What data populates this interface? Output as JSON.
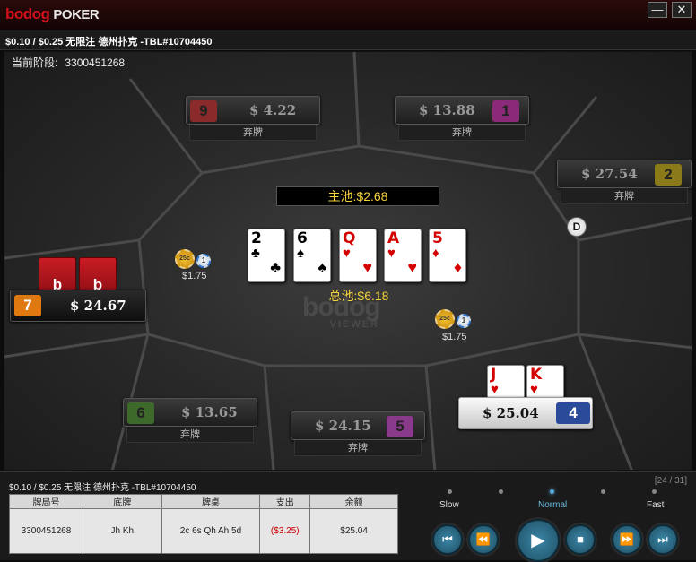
{
  "titlebar": {
    "logo_brand": "bodog",
    "logo_product": "POKER",
    "minimize": "—",
    "close": "✕"
  },
  "subtitle": "$0.10 / $0.25 无限注 德州扑克 -TBL#10704450",
  "stage": {
    "label": "当前阶段:",
    "value": "3300451268"
  },
  "seats": [
    {
      "num": "9",
      "stack": "$ 4.22",
      "status": "弃牌",
      "color": "#8a2a2a"
    },
    {
      "num": "1",
      "stack": "$ 13.88",
      "status": "弃牌",
      "color": "#8a2a78"
    },
    {
      "num": "2",
      "stack": "$ 27.54",
      "status": "弃牌",
      "color": "#8a7a1a"
    },
    {
      "num": "7",
      "stack": "$ 24.67",
      "status": "",
      "color": "#e07a10"
    },
    {
      "num": "6",
      "stack": "$ 13.65",
      "status": "弃牌",
      "color": "#3d6a2a"
    },
    {
      "num": "5",
      "stack": "$ 24.15",
      "status": "弃牌",
      "color": "#8a3a8a"
    },
    {
      "num": "4",
      "stack": "$ 25.04",
      "status": "",
      "color": "#2a4a9a"
    }
  ],
  "pot": {
    "main": "主池:$2.68",
    "total": "总池:$6.18"
  },
  "board": [
    {
      "rank": "2",
      "suit": "♣",
      "color": "black"
    },
    {
      "rank": "6",
      "suit": "♠",
      "color": "black"
    },
    {
      "rank": "Q",
      "suit": "♥",
      "color": "red"
    },
    {
      "rank": "A",
      "suit": "♥",
      "color": "red"
    },
    {
      "rank": "5",
      "suit": "♦",
      "color": "red"
    }
  ],
  "hero_cards": [
    {
      "rank": "J",
      "suit": "♥",
      "color": "red"
    },
    {
      "rank": "K",
      "suit": "♥",
      "color": "red"
    }
  ],
  "bets": {
    "left": "$1.75",
    "right": "$1.75"
  },
  "chips": {
    "big": "25c",
    "small": "1"
  },
  "facedown_label": "b",
  "dealer": "D",
  "watermark": {
    "logo": "bodog",
    "sub": "VIEWER"
  },
  "history": {
    "title": "$0.10 / $0.25 无限注 德州扑克 -TBL#10704450",
    "headers": [
      "牌局号",
      "底牌",
      "牌桌",
      "支出",
      "余额"
    ],
    "row": [
      "3300451268",
      "Jh Kh",
      "2c 6s Qh Ah 5d",
      "($3.25)",
      "$25.04"
    ]
  },
  "replay": {
    "counter": "[24 / 31]",
    "speeds": [
      "Slow",
      "Normal",
      "Fast"
    ],
    "controls": {
      "first": "⏮",
      "prev": "⏪",
      "play": "▶",
      "stop": "■",
      "next": "⏩",
      "last": "⏭"
    }
  }
}
